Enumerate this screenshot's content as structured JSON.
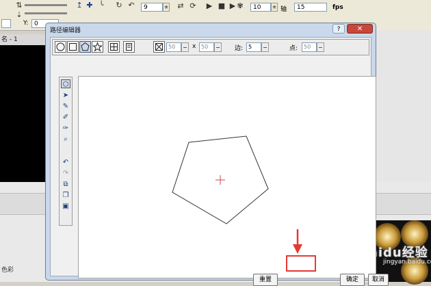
{
  "background_app": {
    "toolbar": {
      "field_frame": "9",
      "field_value": "10",
      "field_fps_value": "15",
      "fps_label": "fps",
      "axis_label": "轴",
      "y_label": "Y:",
      "y_value": "0"
    },
    "tab_label": "名 - 1",
    "color_label": "色彩"
  },
  "watermark": {
    "main": "Baidu经验",
    "sub": "jingyan.baidu.com"
  },
  "dialog": {
    "title": "路径编辑器",
    "help_label": "?",
    "close_label": "✕",
    "toolbar": {
      "width_value": "50",
      "x_sep": "x",
      "height_value": "50",
      "edges_label": "边:",
      "edges_value": "5",
      "points_label": "点:",
      "points_value": "50"
    },
    "buttons": {
      "reset": "重置",
      "ok": "确定",
      "cancel": "取消"
    }
  },
  "colors": {
    "highlight": "#e53935",
    "center_mark": "#d04050",
    "pentagon_stroke": "#333333"
  }
}
